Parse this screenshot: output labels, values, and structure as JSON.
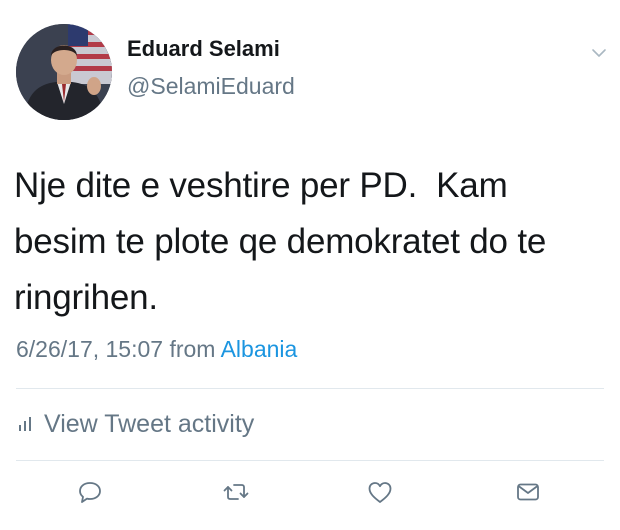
{
  "author": {
    "name": "Eduard Selami",
    "handle": "@SelamiEduard"
  },
  "tweet": {
    "text_lines": [
      "Nje dite e veshtire per PD.  Kam",
      "besim te plote qe demokratet do te",
      "ringrihen."
    ],
    "timestamp": "6/26/17, 15:07",
    "from_label": "from",
    "location": "Albania"
  },
  "activity": {
    "label": "View Tweet activity",
    "icon": "bar-chart-icon"
  },
  "actions": {
    "icons": [
      "reply-icon",
      "retweet-icon",
      "like-icon",
      "direct-message-icon"
    ]
  },
  "colors": {
    "link": "#1b95e0",
    "secondary_text": "#657786",
    "primary_text": "#14171a",
    "divider": "#e1e8ed"
  }
}
